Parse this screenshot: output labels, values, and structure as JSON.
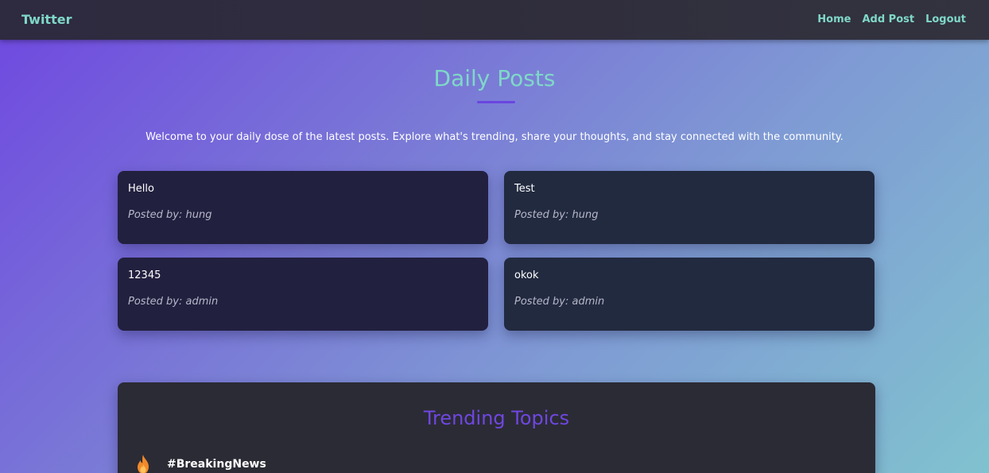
{
  "navbar": {
    "brand": "Twitter",
    "links": [
      {
        "label": "Home"
      },
      {
        "label": "Add Post"
      },
      {
        "label": "Logout"
      }
    ]
  },
  "header": {
    "title": "Daily Posts",
    "intro": "Welcome to your daily dose of the latest posts. Explore what's trending, share your thoughts, and stay connected with the community."
  },
  "posts": [
    {
      "content": "Hello",
      "author": "Posted by: hung"
    },
    {
      "content": "Test",
      "author": "Posted by: hung"
    },
    {
      "content": "12345",
      "author": "Posted by: admin"
    },
    {
      "content": "okok",
      "author": "Posted by: admin"
    }
  ],
  "trending": {
    "title": "Trending Topics",
    "items": [
      {
        "icon": "fire-icon",
        "tag": "#BreakingNews"
      }
    ]
  },
  "colors": {
    "accent_teal": "#7fd8c8",
    "accent_purple": "#6f47e0",
    "navbar_bg": "#2f2d3c",
    "card_bg": "#22203f",
    "trending_bg": "#2b2b35"
  }
}
